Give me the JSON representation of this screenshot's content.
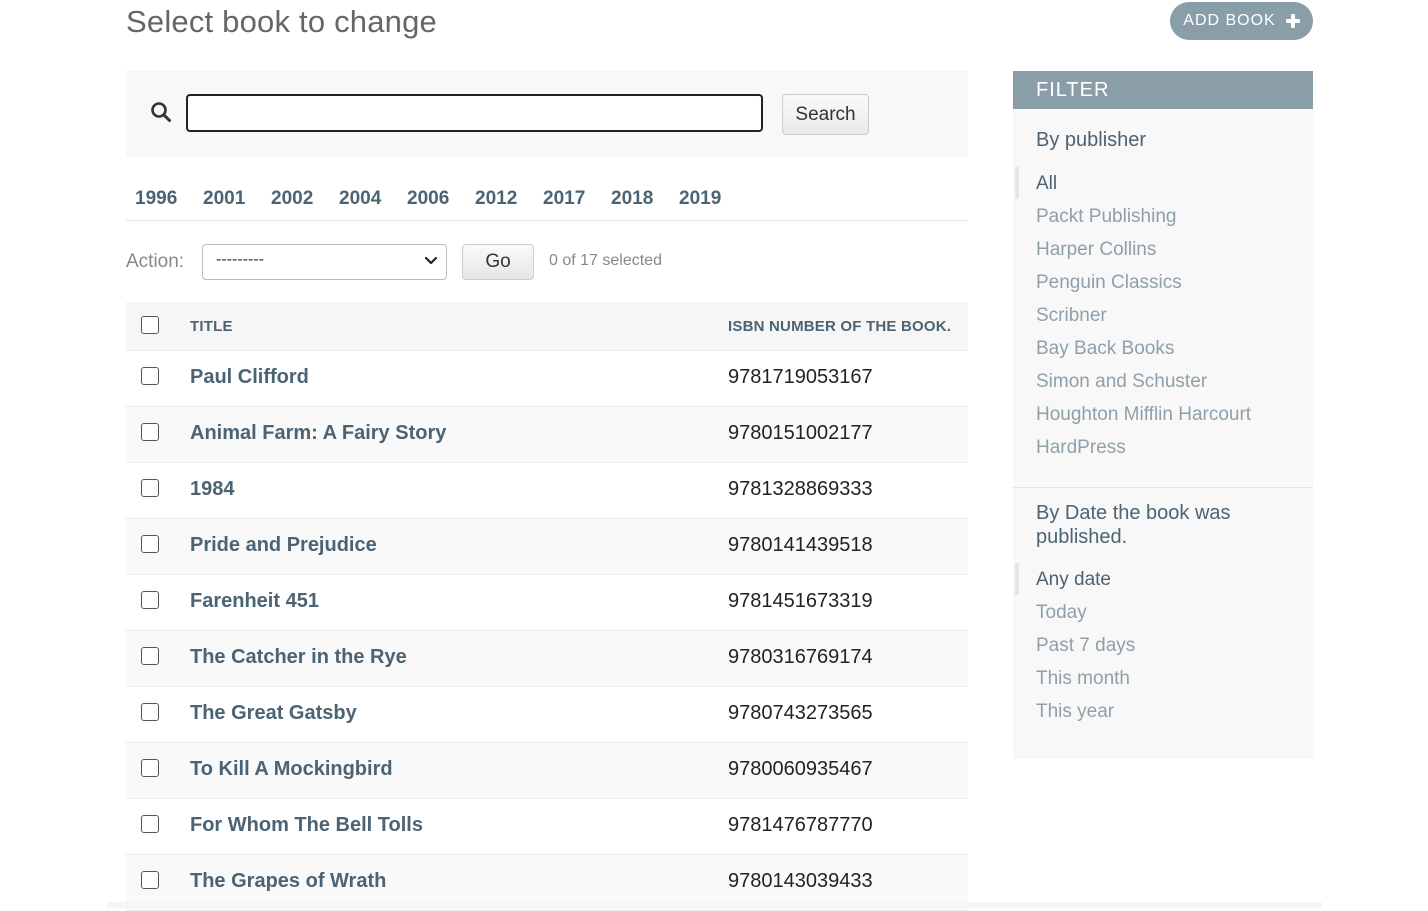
{
  "header": {
    "title": "Select book to change",
    "add_label": "ADD BOOK"
  },
  "search": {
    "button_label": "Search",
    "value": ""
  },
  "date_hierarchy": [
    "1996",
    "2001",
    "2002",
    "2004",
    "2006",
    "2012",
    "2017",
    "2018",
    "2019"
  ],
  "actions": {
    "label": "Action:",
    "selected_option": "---------",
    "go_label": "Go",
    "selection_text": "0 of 17 selected"
  },
  "table": {
    "columns": [
      "TITLE",
      "ISBN NUMBER OF THE BOOK."
    ],
    "rows": [
      {
        "title": "Paul Clifford",
        "isbn": "9781719053167"
      },
      {
        "title": "Animal Farm: A Fairy Story",
        "isbn": "9780151002177"
      },
      {
        "title": "1984",
        "isbn": "9781328869333"
      },
      {
        "title": "Pride and Prejudice",
        "isbn": "9780141439518"
      },
      {
        "title": "Farenheit 451",
        "isbn": "9781451673319"
      },
      {
        "title": "The Catcher in the Rye",
        "isbn": "9780316769174"
      },
      {
        "title": "The Great Gatsby",
        "isbn": "9780743273565"
      },
      {
        "title": "To Kill A Mockingbird",
        "isbn": "9780060935467"
      },
      {
        "title": "For Whom The Bell Tolls",
        "isbn": "9781476787770"
      },
      {
        "title": "The Grapes of Wrath",
        "isbn": "9780143039433"
      }
    ]
  },
  "filter": {
    "heading": "FILTER",
    "publisher": {
      "title": "By publisher",
      "options": [
        "All",
        "Packt Publishing",
        "Harper Collins",
        "Penguin Classics",
        "Scribner",
        "Bay Back Books",
        "Simon and Schuster",
        "Houghton Mifflin Harcourt",
        "HardPress"
      ]
    },
    "date": {
      "title": "By Date the book was published.",
      "options": [
        "Any date",
        "Today",
        "Past 7 days",
        "This month",
        "This year"
      ]
    }
  }
}
